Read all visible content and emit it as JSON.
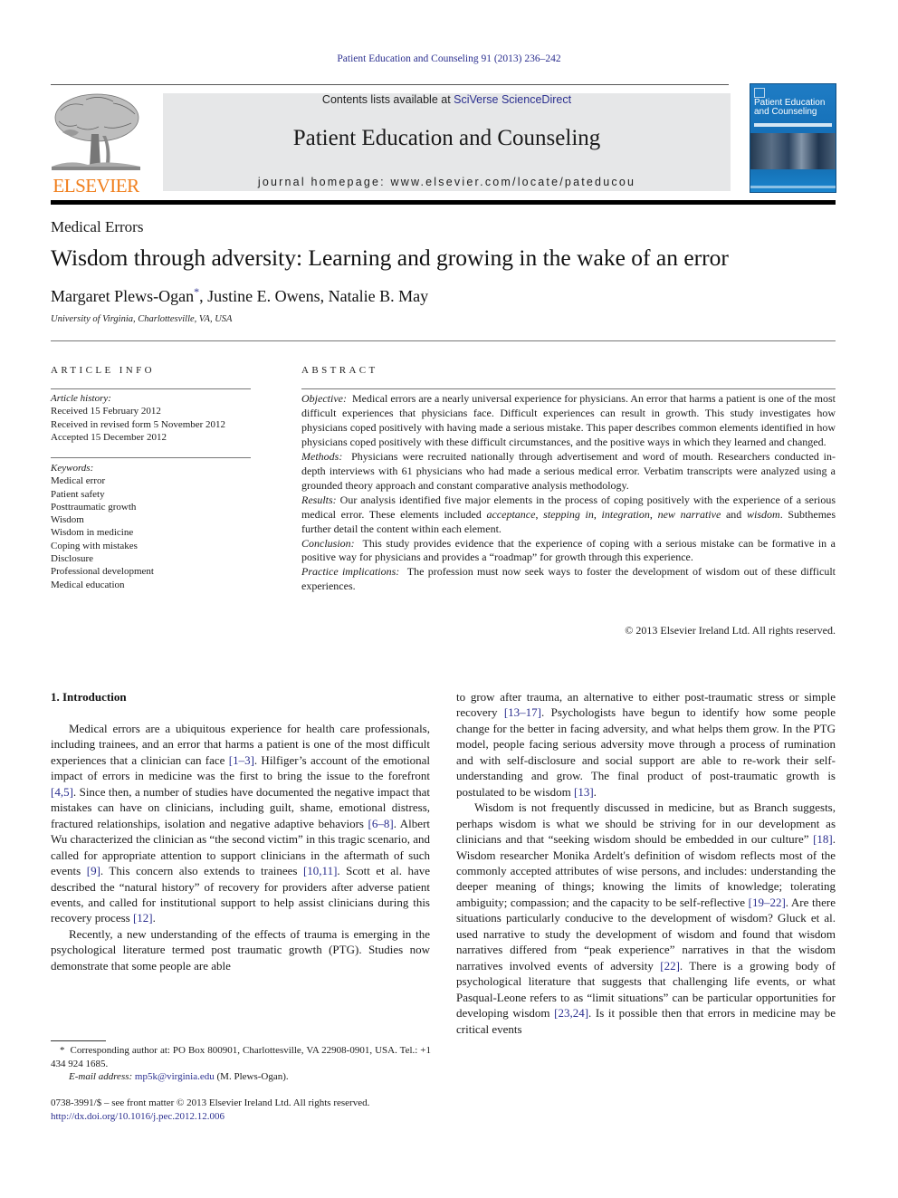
{
  "header": {
    "running_head": "Patient Education and Counseling 91 (2013) 236–242",
    "contents_prefix": "Contents lists available at ",
    "contents_link": "SciVerse ScienceDirect",
    "journal_title": "Patient Education and Counseling",
    "homepage": "journal homepage: www.elsevier.com/locate/pateducou",
    "publisher_logo_text": "ELSEVIER",
    "cover": {
      "title_line1": "Patient Education",
      "title_line2": "and Counseling"
    },
    "colors": {
      "link": "#2b2f8f",
      "elsevier_orange": "#f07f1d",
      "banner_gray": "#e6e7e8",
      "cover_blue": "#1f7cc4"
    }
  },
  "article": {
    "section": "Medical Errors",
    "title": "Wisdom through adversity: Learning and growing in the wake of an error",
    "authors": [
      {
        "name": "Margaret Plews-Ogan",
        "marker": "*",
        "sep": ", "
      },
      {
        "name": "Justine E. Owens",
        "sep": ", "
      },
      {
        "name": "Natalie B. May"
      }
    ],
    "affiliation": "University of Virginia, Charlottesville, VA, USA"
  },
  "article_info": {
    "heading": "ARTICLE INFO",
    "history_label": "Article history:",
    "history": [
      "Received 15 February 2012",
      "Received in revised form 5 November 2012",
      "Accepted 15 December 2012"
    ],
    "keywords_label": "Keywords:",
    "keywords": [
      "Medical error",
      "Patient safety",
      "Posttraumatic growth",
      "Wisdom",
      "Wisdom in medicine",
      "Coping with mistakes",
      "Disclosure",
      "Professional development",
      "Medical education"
    ]
  },
  "abstract": {
    "heading": "ABSTRACT",
    "objective_label": "Objective:",
    "objective": "Medical errors are a nearly universal experience for physicians. An error that harms a patient is one of the most difficult experiences that physicians face. Difficult experiences can result in growth. This study investigates how physicians coped positively with having made a serious mistake. This paper describes common elements identified in how physicians coped positively with these difficult circumstances, and the positive ways in which they learned and changed.",
    "methods_label": "Methods:",
    "methods": "Physicians were recruited nationally through advertisement and word of mouth. Researchers conducted in-depth interviews with 61 physicians who had made a serious medical error. Verbatim transcripts were analyzed using a grounded theory approach and constant comparative analysis methodology.",
    "results_label": "Results:",
    "results_a": "Our analysis identified five major elements in the process of coping positively with the experience of a serious medical error. These elements included ",
    "results_el1": "acceptance",
    "results_sep1": ", ",
    "results_el2": "stepping in",
    "results_sep2": ", ",
    "results_el3": "integration",
    "results_sep3": ", ",
    "results_el4": "new narrative",
    "results_and": " and ",
    "results_el5": "wisdom",
    "results_b": ". Subthemes further detail the content within each element.",
    "conclusion_label": "Conclusion:",
    "conclusion": "This study provides evidence that the experience of coping with a serious mistake can be formative in a positive way for physicians and provides a “roadmap” for growth through this experience.",
    "practice_label": "Practice implications:",
    "practice": "The profession must now seek ways to foster the development of wisdom out of these difficult experiences.",
    "copyright": "© 2013 Elsevier Ireland Ltd. All rights reserved."
  },
  "body": {
    "section_heading": "1.  Introduction",
    "left_p1": [
      {
        "t": "Medical errors are a ubiquitous experience for health care professionals, including trainees, and an error that harms a patient is one of the most difficult experiences that a clinician can face "
      },
      {
        "ref": "[1–3]"
      },
      {
        "t": ". Hilfiger’s account of the emotional impact of errors in medicine was the first to bring the issue to the forefront "
      },
      {
        "ref": "[4,5]"
      },
      {
        "t": ". Since then, a number of studies have documented the negative impact that mistakes can have on clinicians, including guilt, shame, emotional distress, fractured relationships, isolation and negative adaptive behaviors "
      },
      {
        "ref": "[6–8]"
      },
      {
        "t": ". Albert Wu characterized the clinician as “the second victim” in this tragic scenario, and called for appropriate attention to support clinicians in the aftermath of such events "
      },
      {
        "ref": "[9]"
      },
      {
        "t": ". This concern also extends to trainees "
      },
      {
        "ref": "[10,11]"
      },
      {
        "t": ". Scott et al. have described the “natural history” of recovery for providers after adverse patient events, and called for institutional support to help assist clinicians during this recovery process "
      },
      {
        "ref": "[12]"
      },
      {
        "t": "."
      }
    ],
    "left_p2": [
      {
        "t": "Recently, a new understanding of the effects of trauma is emerging in the psychological literature termed post traumatic growth (PTG). Studies now demonstrate that some people are able"
      }
    ],
    "right_p1": [
      {
        "t": "to grow after trauma, an alternative to either post-traumatic stress or simple recovery "
      },
      {
        "ref": "[13–17]"
      },
      {
        "t": ". Psychologists have begun to identify how some people change for the better in facing adversity, and what helps them grow. In the PTG model, people facing serious adversity move through a process of rumination and with self-disclosure and social support are able to re-work their self-understanding and grow. The final product of post-traumatic growth is postulated to be wisdom "
      },
      {
        "ref": "[13]"
      },
      {
        "t": "."
      }
    ],
    "right_p2": [
      {
        "t": "Wisdom is not frequently discussed in medicine, but as Branch suggests, perhaps wisdom is what we should be striving for in our development as clinicians and that “seeking wisdom should be embedded in our culture” "
      },
      {
        "ref": "[18]"
      },
      {
        "t": ". Wisdom researcher Monika Ardelt's definition of wisdom reflects most of the commonly accepted attributes of wise persons, and includes: understanding the deeper meaning of things; knowing the limits of knowledge; tolerating ambiguity; compassion; and the capacity to be self-reflective "
      },
      {
        "ref": "[19–22]"
      },
      {
        "t": ". Are there situations particularly conducive to the development of wisdom? Gluck et al. used narrative to study the development of wisdom and found that wisdom narratives differed from “peak experience” narratives in that the wisdom narratives involved events of adversity "
      },
      {
        "ref": "[22]"
      },
      {
        "t": ". There is a growing body of psychological literature that suggests that challenging life events, or what Pasqual-Leone refers to as “limit situations” can be particular opportunities for developing wisdom "
      },
      {
        "ref": "[23,24]"
      },
      {
        "t": ". Is it possible then that errors in medicine may be critical events"
      }
    ]
  },
  "footnotes": {
    "marker": "*",
    "corresponding": "Corresponding author at: PO Box 800901, Charlottesville, VA 22908-0901, USA. Tel.: +1 434 924 1685.",
    "email_label": "E-mail address:",
    "email": "mp5k@virginia.edu",
    "email_suffix": " (M. Plews-Ogan).",
    "front_matter": "0738-3991/$ – see front matter © 2013 Elsevier Ireland Ltd. All rights reserved.",
    "doi": "http://dx.doi.org/10.1016/j.pec.2012.12.006"
  }
}
